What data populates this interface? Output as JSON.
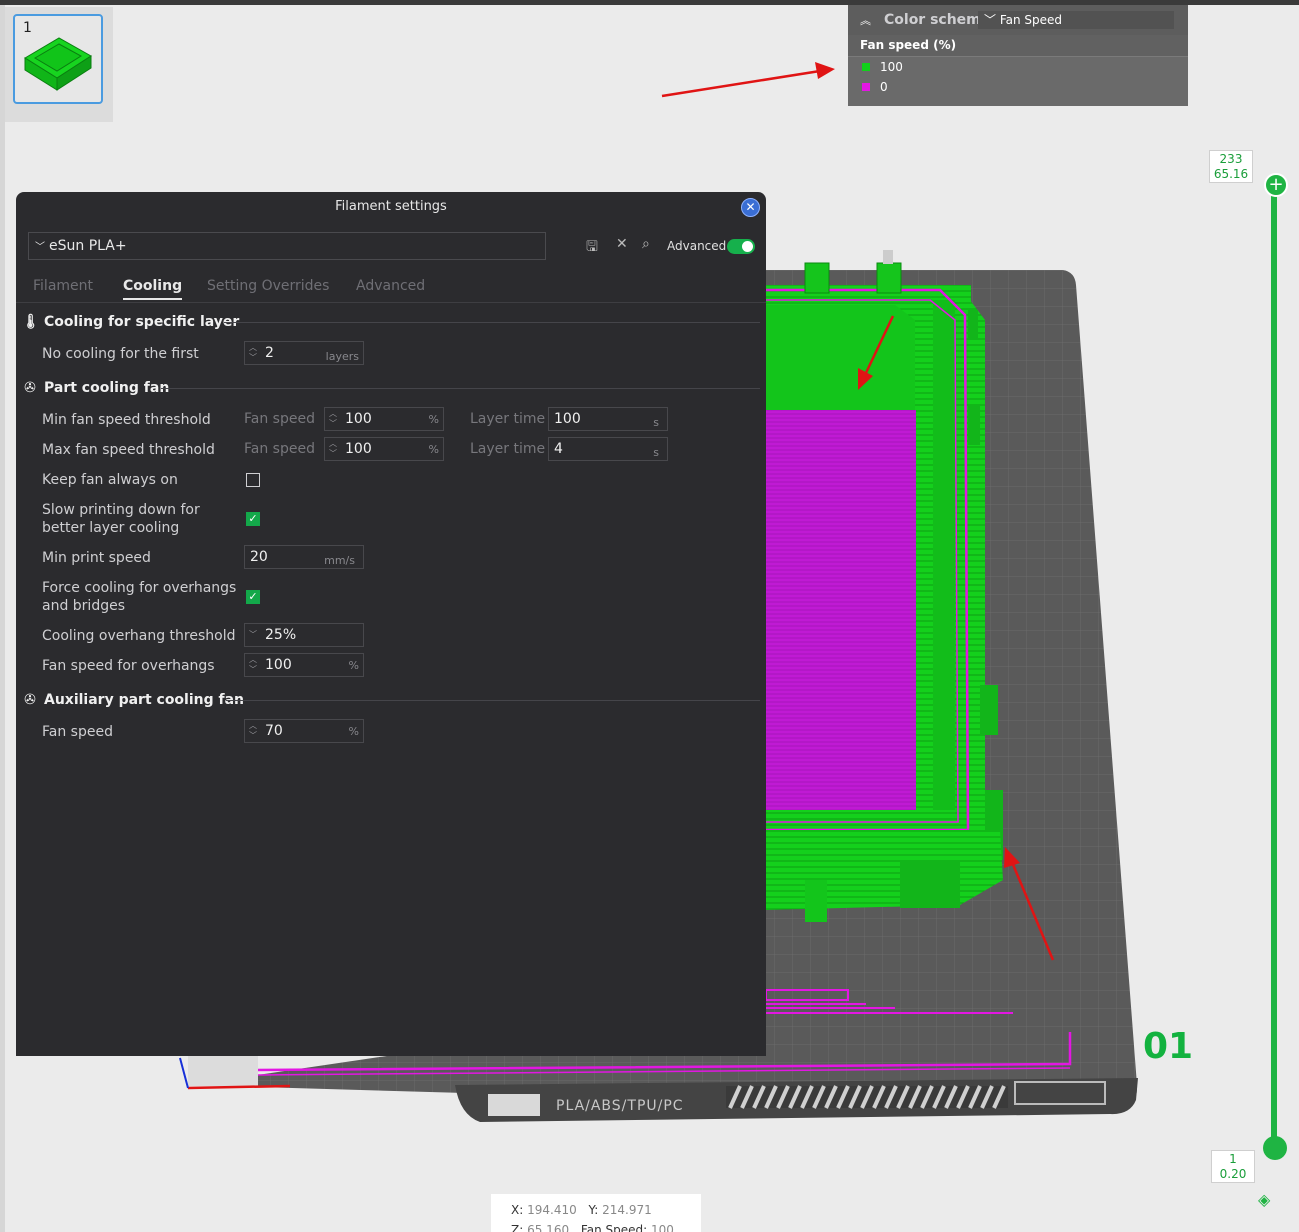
{
  "thumbnail": {
    "number": "1"
  },
  "legend": {
    "label": "Color scheme",
    "selected": "Fan Speed",
    "title": "Fan speed (%)",
    "items": [
      {
        "value": "100",
        "color": "#11d11a"
      },
      {
        "value": "0",
        "color": "#e316e3"
      }
    ]
  },
  "slider": {
    "top_layer": "233",
    "top_height": "65.16",
    "bottom_layer": "1",
    "bottom_height": "0.20",
    "color": "#1fb443"
  },
  "bed": {
    "text": "PLA/ABS/TPU/PC",
    "number": "01"
  },
  "coords": {
    "x_label": "X:",
    "x": "194.410",
    "y_label": "Y:",
    "y": "214.971",
    "z_label": "Z:",
    "z": "65.160",
    "fan_label": "Fan Speed:",
    "fan": "100"
  },
  "dialog": {
    "title": "Filament settings",
    "preset": "eSun PLA+",
    "advanced_label": "Advanced",
    "advanced_on": true,
    "tabs": [
      "Filament",
      "Cooling",
      "Setting Overrides",
      "Advanced"
    ],
    "active_tab": "Cooling",
    "sections": {
      "specific_layer": "Cooling for specific layer",
      "part_fan": "Part cooling fan",
      "aux_fan": "Auxiliary part cooling fan"
    },
    "no_cooling": {
      "label": "No cooling for the first",
      "value": "2",
      "unit": "layers"
    },
    "min_fan": {
      "label": "Min fan speed threshold",
      "fan_label": "Fan speed",
      "fan_value": "100",
      "fan_unit": "%",
      "time_label": "Layer time",
      "time_value": "100",
      "time_unit": "s"
    },
    "max_fan": {
      "label": "Max fan speed threshold",
      "fan_label": "Fan speed",
      "fan_value": "100",
      "fan_unit": "%",
      "time_label": "Layer time",
      "time_value": "4",
      "time_unit": "s"
    },
    "keep_fan": {
      "label": "Keep fan always on",
      "checked": false
    },
    "slow_down": {
      "label_1": "Slow printing down for",
      "label_2": "better layer cooling",
      "checked": true
    },
    "min_print_speed": {
      "label": "Min print speed",
      "value": "20",
      "unit": "mm/s"
    },
    "force_cooling": {
      "label_1": "Force cooling for overhangs",
      "label_2": "and bridges",
      "checked": true
    },
    "overhang_threshold": {
      "label": "Cooling overhang threshold",
      "value": "25%"
    },
    "overhang_fan": {
      "label": "Fan speed for overhangs",
      "value": "100",
      "unit": "%"
    },
    "aux_fan_speed": {
      "label": "Fan speed",
      "value": "70",
      "unit": "%"
    }
  }
}
